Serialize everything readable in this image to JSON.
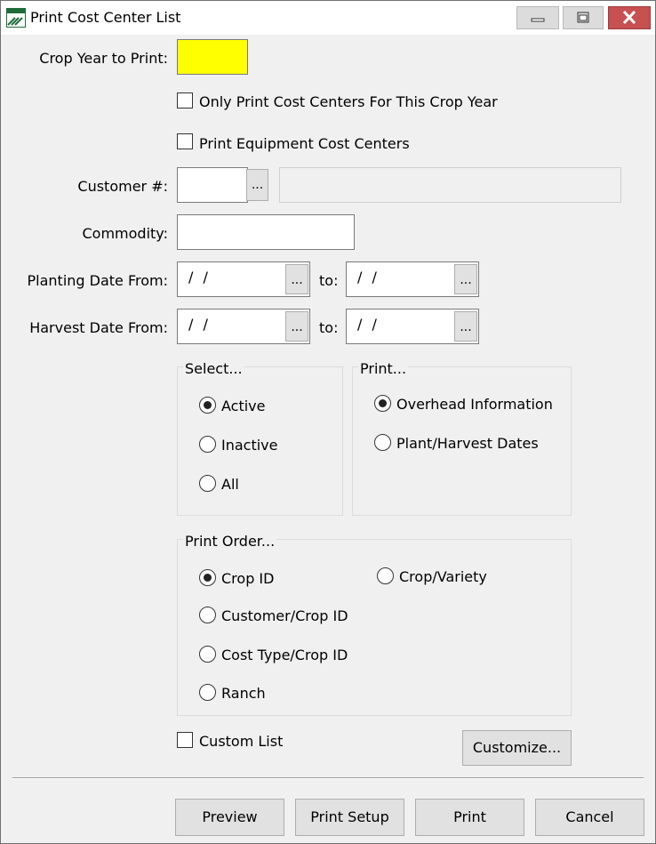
{
  "window": {
    "title": "Print Cost Center List"
  },
  "titlebar": {
    "min_icon": "minimize-icon",
    "max_icon": "maximize-icon",
    "close_icon": "close-icon"
  },
  "form": {
    "crop_year_label": "Crop Year to Print:",
    "crop_year_value": "",
    "crop_year_highlight": "#ffff00",
    "only_this_year_label": "Only Print Cost Centers For This Crop Year",
    "equipment_label": "Print Equipment Cost Centers",
    "customer_label": "Customer #:",
    "customer_value": "",
    "customer_name_value": "",
    "commodity_label": "Commodity:",
    "commodity_value": "",
    "planting_label": "Planting Date From:",
    "planting_from": "/ /",
    "planting_to": "/ /",
    "harvest_label": "Harvest Date From:",
    "harvest_from": "/ /",
    "harvest_to": "/ /",
    "to_label": "to:",
    "ellipsis": "..."
  },
  "select_group": {
    "title": "Select...",
    "options": [
      "Active",
      "Inactive",
      "All"
    ],
    "selected": "Active"
  },
  "print_group": {
    "title": "Print...",
    "options": [
      "Overhead Information",
      "Plant/Harvest Dates"
    ],
    "selected": "Overhead Information"
  },
  "order_group": {
    "title": "Print Order...",
    "options": [
      "Crop ID",
      "Crop/Variety",
      "Customer/Crop ID",
      "Cost Type/Crop ID",
      "Ranch"
    ],
    "selected": "Crop ID"
  },
  "custom": {
    "label": "Custom List",
    "customize_button": "Customize..."
  },
  "footer": {
    "preview": "Preview",
    "print_setup": "Print Setup",
    "print": "Print",
    "cancel": "Cancel"
  }
}
